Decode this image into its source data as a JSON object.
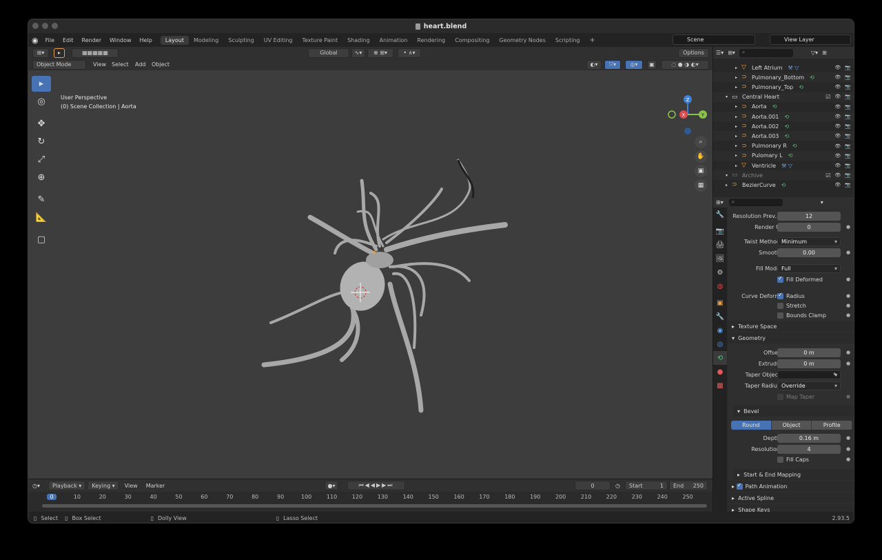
{
  "window": {
    "title": "heart.blend"
  },
  "menu": [
    "File",
    "Edit",
    "Render",
    "Window",
    "Help"
  ],
  "workspaces": [
    "Layout",
    "Modeling",
    "Sculpting",
    "UV Editing",
    "Texture Paint",
    "Shading",
    "Animation",
    "Rendering",
    "Compositing",
    "Geometry Nodes",
    "Scripting"
  ],
  "workspace_add": "+",
  "active_workspace": "Layout",
  "scene": {
    "name": "Scene",
    "view_layer": "View Layer"
  },
  "viewport_header": {
    "transform": "Global",
    "options": "Options",
    "mode": "Object Mode",
    "menus": [
      "View",
      "Select",
      "Add",
      "Object"
    ]
  },
  "viewport": {
    "perspective": "User Perspective",
    "collection": "(0) Scene Collection | Aorta",
    "axes": {
      "x": "X",
      "y": "Y",
      "z": "Z"
    }
  },
  "outliner": {
    "rows": [
      {
        "label": "Left Atrium",
        "kind": "mesh",
        "indent": 2
      },
      {
        "label": "Pulmonary_Bottom",
        "kind": "curve",
        "indent": 2
      },
      {
        "label": "Pulmonary_Top",
        "kind": "curve",
        "indent": 2
      },
      {
        "label": "Central Heart",
        "kind": "collection",
        "indent": 1
      },
      {
        "label": "Aorta",
        "kind": "curve",
        "indent": 2
      },
      {
        "label": "Aorta.001",
        "kind": "curve",
        "indent": 2
      },
      {
        "label": "Aorta.002",
        "kind": "curve",
        "indent": 2
      },
      {
        "label": "Aorta.003",
        "kind": "curve",
        "indent": 2
      },
      {
        "label": "Pulmonary R",
        "kind": "curve",
        "indent": 2
      },
      {
        "label": "Pulomary L",
        "kind": "curve",
        "indent": 2
      },
      {
        "label": "Ventricle",
        "kind": "mesh",
        "indent": 2
      },
      {
        "label": "Archive",
        "kind": "collection-dim",
        "indent": 1
      },
      {
        "label": "BezierCurve",
        "kind": "curve",
        "indent": 1
      }
    ]
  },
  "properties": {
    "resolution_preview": {
      "label": "Resolution Prev...",
      "value": "12"
    },
    "render_u": {
      "label": "Render U",
      "value": "0"
    },
    "twist_method": {
      "label": "Twist Method",
      "value": "Minimum"
    },
    "smooth": {
      "label": "Smooth",
      "value": "0.00"
    },
    "fill_mode": {
      "label": "Fill Mode",
      "value": "Full"
    },
    "fill_deformed": {
      "label": "Fill Deformed",
      "checked": true
    },
    "curve_deform": {
      "label": "Curve Deform"
    },
    "radius": {
      "label": "Radius",
      "checked": true
    },
    "stretch": {
      "label": "Stretch",
      "checked": false
    },
    "bounds_clamp": {
      "label": "Bounds Clamp",
      "checked": false
    },
    "texture_space": "Texture Space",
    "geometry": "Geometry",
    "offset": {
      "label": "Offset",
      "value": "0 m"
    },
    "extrude": {
      "label": "Extrude",
      "value": "0 m"
    },
    "taper_object": {
      "label": "Taper Object",
      "value": ""
    },
    "taper_radius": {
      "label": "Taper Radius",
      "value": "Override"
    },
    "map_taper": {
      "label": "Map Taper",
      "checked": false
    },
    "bevel": "Bevel",
    "bevel_modes": [
      "Round",
      "Object",
      "Profile"
    ],
    "bevel_mode_active": "Round",
    "depth": {
      "label": "Depth",
      "value": "0.16 m"
    },
    "resolution": {
      "label": "Resolution",
      "value": "4"
    },
    "fill_caps": {
      "label": "Fill Caps",
      "checked": false
    },
    "start_end": "Start & End Mapping",
    "path_animation": {
      "label": "Path Animation",
      "checked": true
    },
    "active_spline": "Active Spline",
    "shape_keys": "Shape Keys"
  },
  "timeline": {
    "menus": [
      "Playback",
      "Keying",
      "View",
      "Marker"
    ],
    "current_frame": "0",
    "start_label": "Start",
    "start": "1",
    "end_label": "End",
    "end": "250",
    "ticks": [
      "0",
      "10",
      "20",
      "30",
      "40",
      "50",
      "60",
      "70",
      "80",
      "90",
      "100",
      "110",
      "120",
      "130",
      "140",
      "150",
      "160",
      "170",
      "180",
      "190",
      "200",
      "210",
      "220",
      "230",
      "240",
      "250"
    ]
  },
  "statusbar": {
    "select": "Select",
    "box_select": "Box Select",
    "dolly": "Dolly View",
    "lasso": "Lasso Select",
    "version": "2.93.5"
  },
  "colors": {
    "accent": "#4772b3",
    "curve_icon": "#e8a04a",
    "mesh_icon": "#e8a04a",
    "axis_x": "#e0484f",
    "axis_y": "#8bc34a",
    "axis_z": "#3b82d8"
  }
}
